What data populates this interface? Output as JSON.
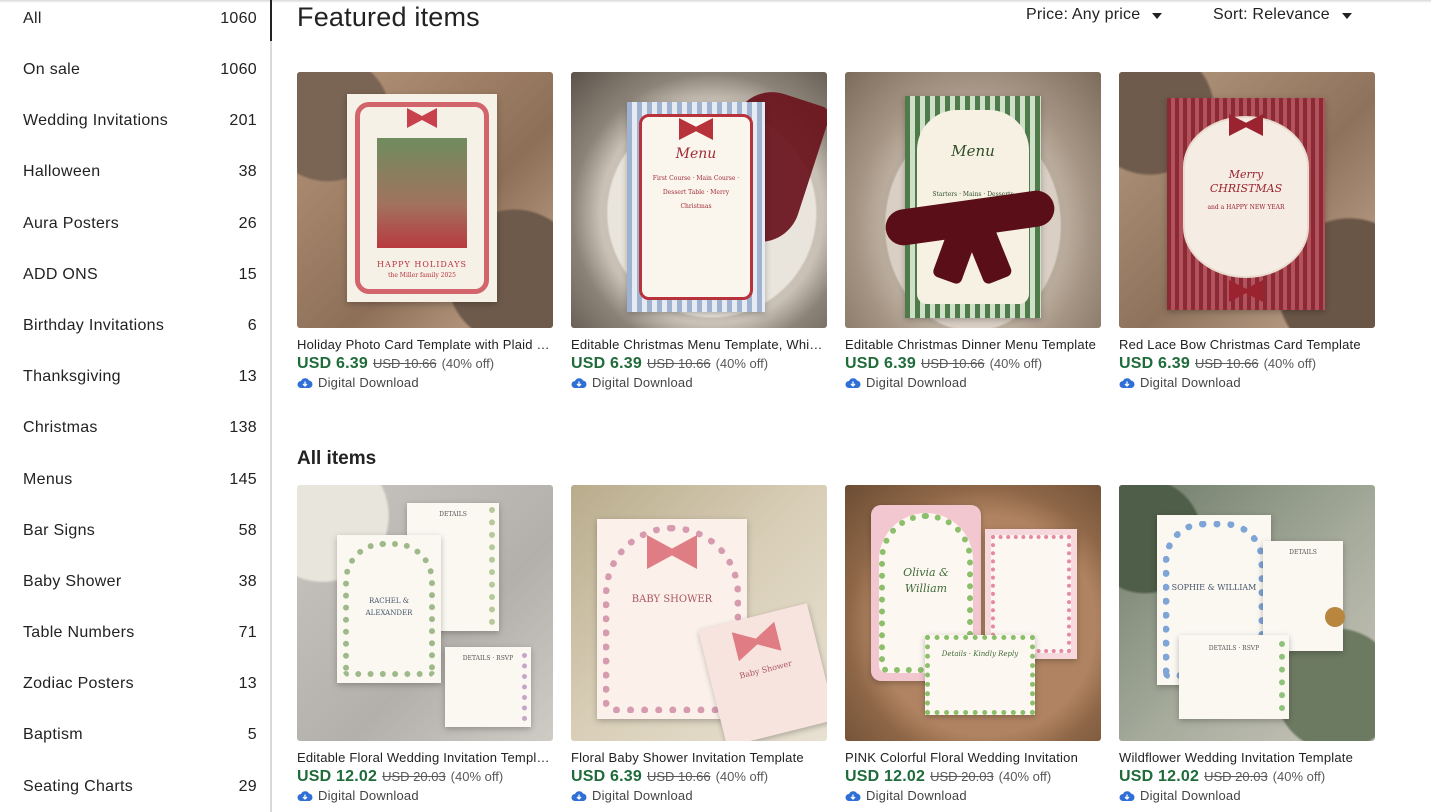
{
  "sidebar": {
    "categories": [
      {
        "label": "All",
        "count": "1060"
      },
      {
        "label": "On sale",
        "count": "1060"
      },
      {
        "label": "Wedding Invitations",
        "count": "201"
      },
      {
        "label": "Halloween",
        "count": "38"
      },
      {
        "label": "Aura Posters",
        "count": "26"
      },
      {
        "label": "ADD ONS",
        "count": "15"
      },
      {
        "label": "Birthday Invitations",
        "count": "6"
      },
      {
        "label": "Thanksgiving",
        "count": "13"
      },
      {
        "label": "Christmas",
        "count": "138"
      },
      {
        "label": "Menus",
        "count": "145"
      },
      {
        "label": "Bar Signs",
        "count": "58"
      },
      {
        "label": "Baby Shower",
        "count": "38"
      },
      {
        "label": "Table Numbers",
        "count": "71"
      },
      {
        "label": "Zodiac Posters",
        "count": "13"
      },
      {
        "label": "Baptism",
        "count": "5"
      },
      {
        "label": "Seating Charts",
        "count": "29"
      }
    ],
    "selected": "All"
  },
  "header": {
    "featured_title": "Featured items",
    "price_filter": "Price: Any price",
    "sort": "Sort: Relevance",
    "all_title": "All items"
  },
  "featured": [
    {
      "title": "Holiday Photo Card Template with Plaid Bow",
      "price": "USD 6.39",
      "original": "USD 10.66",
      "discount": "(40% off)",
      "delivery": "Digital Download",
      "art": {
        "card_text": "HAPPY HOLIDAYS",
        "card_sub": "the Miller family 2025"
      }
    },
    {
      "title": "Editable Christmas Menu Template, Whimsical Bow",
      "price": "USD 6.39",
      "original": "USD 10.66",
      "discount": "(40% off)",
      "delivery": "Digital Download",
      "art": {
        "card_text": "Menu",
        "card_sub": "First Course · Main Course · Dessert Table · Merry Christmas"
      }
    },
    {
      "title": "Editable Christmas Dinner Menu Template",
      "price": "USD 6.39",
      "original": "USD 10.66",
      "discount": "(40% off)",
      "delivery": "Digital Download",
      "art": {
        "card_text": "Menu",
        "card_sub": "Starters · Mains · Desserts"
      }
    },
    {
      "title": "Red Lace Bow Christmas Card Template",
      "price": "USD 6.39",
      "original": "USD 10.66",
      "discount": "(40% off)",
      "delivery": "Digital Download",
      "art": {
        "card_text": "Merry CHRISTMAS",
        "card_sub": "and a HAPPY NEW YEAR"
      }
    }
  ],
  "all_items": [
    {
      "title": "Editable Floral Wedding Invitation Template",
      "price": "USD 12.02",
      "original": "USD 20.03",
      "discount": "(40% off)",
      "delivery": "Digital Download",
      "art": {
        "card_text": "RACHEL & ALEXANDER",
        "card_sub": "DETAILS · RSVP"
      }
    },
    {
      "title": "Floral Baby Shower Invitation Template",
      "price": "USD 6.39",
      "original": "USD 10.66",
      "discount": "(40% off)",
      "delivery": "Digital Download",
      "art": {
        "card_text": "BABY SHOWER",
        "card_sub": "Baby Shower"
      }
    },
    {
      "title": "PINK Colorful Floral Wedding Invitation",
      "price": "USD 12.02",
      "original": "USD 20.03",
      "discount": "(40% off)",
      "delivery": "Digital Download",
      "art": {
        "card_text": "Olivia & William",
        "card_sub": "Details · Kindly Reply"
      }
    },
    {
      "title": "Wildflower Wedding Invitation Template",
      "price": "USD 12.02",
      "original": "USD 20.03",
      "discount": "(40% off)",
      "delivery": "Digital Download",
      "art": {
        "card_text": "SOPHIE & WILLIAM",
        "card_sub": "DETAILS · RSVP"
      }
    }
  ],
  "colors": {
    "price_green": "#1f6b3a",
    "download_icon_blue": "#2f6fd6",
    "divider": "#d9d9d9"
  }
}
